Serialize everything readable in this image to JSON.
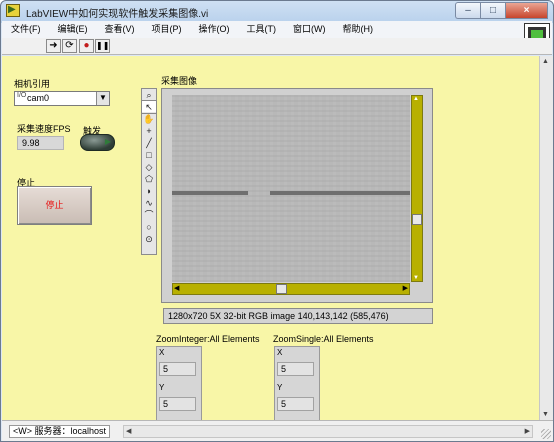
{
  "window": {
    "title": "LabVIEW中如何实现软件触发采集图像.vi",
    "buttons": {
      "minimize": "–",
      "maximize": "□",
      "close": "×"
    }
  },
  "menu": [
    "文件(F)",
    "编辑(E)",
    "查看(V)",
    "项目(P)",
    "操作(O)",
    "工具(T)",
    "窗口(W)",
    "帮助(H)"
  ],
  "toolbar": {
    "icons": [
      "run-arrow-icon",
      "run-continuously-icon",
      "abort-icon",
      "pause-icon"
    ],
    "help_label": "?"
  },
  "panel": {
    "camera_ref_label": "相机引用",
    "camera_io_glyph": "I/O",
    "camera_value": "cam0",
    "fps_label": "采集速度FPS",
    "fps_value": "9.98",
    "trigger_label": "触发",
    "stop_label": "停止",
    "stop_button_text": "停止",
    "image_label": "采集图像",
    "image_info": "1280x720 5X 32-bit RGB image 140,143,142     (585,476)",
    "zoom_integer": {
      "label": "ZoomInteger:All Elements",
      "x_label": "X",
      "x_value": "5",
      "y_label": "Y",
      "y_value": "5"
    },
    "zoom_single": {
      "label": "ZoomSingle:All Elements",
      "x_label": "X",
      "x_value": "5",
      "y_label": "Y",
      "y_value": "5"
    }
  },
  "image_tools": [
    "zoom",
    "pointer",
    "pan",
    "crosshair",
    "line",
    "rectangle",
    "rotated-rectangle",
    "polygon",
    "annulus",
    "freehand",
    "broken-line",
    "oval",
    "point"
  ],
  "status": {
    "project_text": "<W> 服务器：localhost"
  },
  "colors": {
    "panel_bg": "#f8f6a7",
    "scrollbar_olive": "#b8b000",
    "stop_text": "#e81515"
  }
}
